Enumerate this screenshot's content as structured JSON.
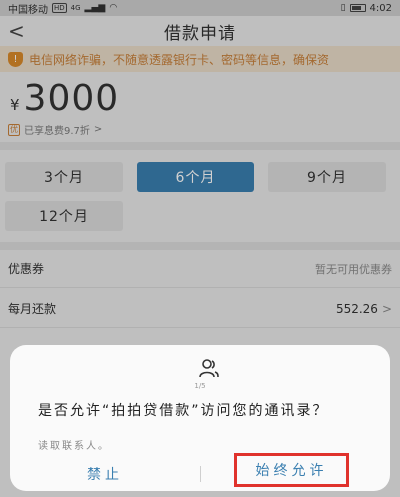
{
  "status_bar": {
    "carrier": "中国移动",
    "hd": "HD",
    "network": "4G",
    "time": "4:02"
  },
  "header": {
    "title": "借款申请"
  },
  "notice": {
    "text": "电信网络诈骗，不随意透露银行卡、密码等信息，确保资"
  },
  "loan": {
    "currency": "¥",
    "amount": "3000",
    "discount_badge": "优",
    "discount_text": "已享息费9.7折"
  },
  "terms": [
    {
      "label": "3个月",
      "selected": false
    },
    {
      "label": "6个月",
      "selected": true
    },
    {
      "label": "9个月",
      "selected": false
    },
    {
      "label": "12个月",
      "selected": false
    }
  ],
  "rows": {
    "coupon_label": "优惠券",
    "coupon_value": "暂无可用优惠券",
    "monthly_label": "每月还款",
    "monthly_value": "552.26"
  },
  "dialog": {
    "pager": "1/5",
    "question": "是否允许“拍拍贷借款”访问您的通讯录？",
    "sub": "读取联系人。",
    "deny": "禁止",
    "allow": "始终允许"
  },
  "colors": {
    "accent": "#3a7fb0",
    "warning": "#c8803a",
    "highlight_border": "#e0322c"
  }
}
